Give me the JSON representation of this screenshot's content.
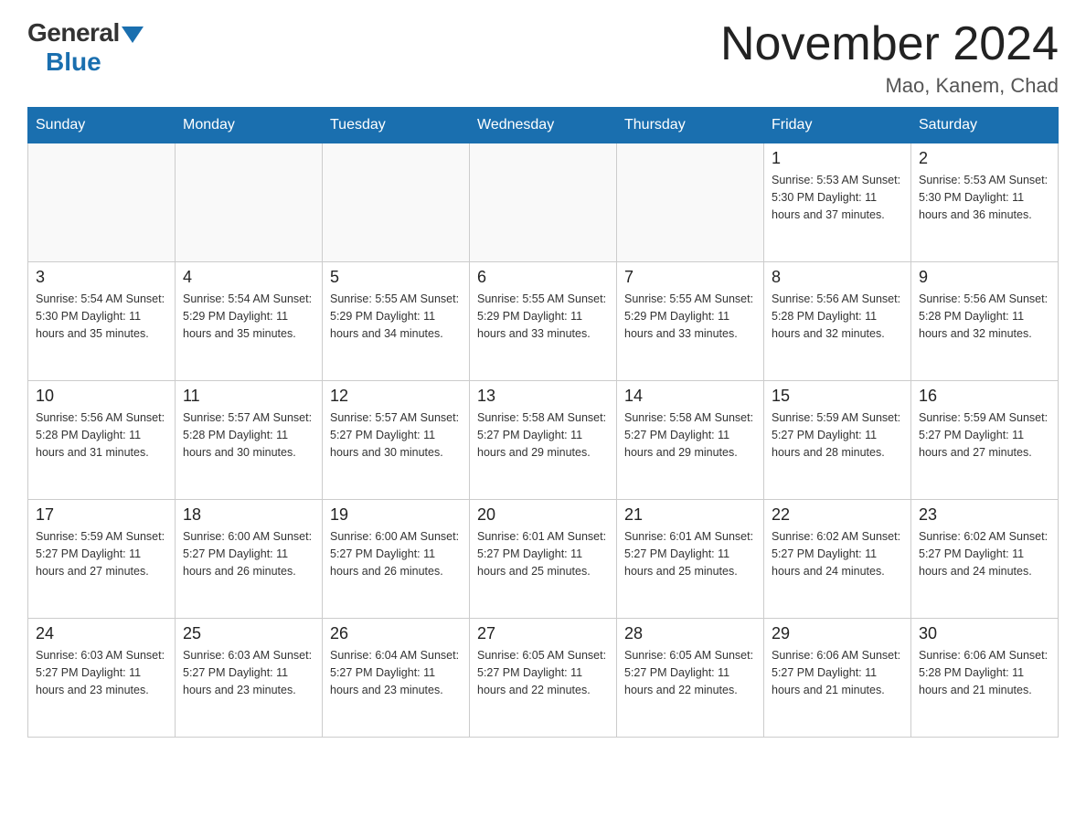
{
  "header": {
    "logo_general": "General",
    "logo_blue": "Blue",
    "month_title": "November 2024",
    "location": "Mao, Kanem, Chad"
  },
  "weekdays": [
    "Sunday",
    "Monday",
    "Tuesday",
    "Wednesday",
    "Thursday",
    "Friday",
    "Saturday"
  ],
  "weeks": [
    [
      {
        "day": "",
        "info": ""
      },
      {
        "day": "",
        "info": ""
      },
      {
        "day": "",
        "info": ""
      },
      {
        "day": "",
        "info": ""
      },
      {
        "day": "",
        "info": ""
      },
      {
        "day": "1",
        "info": "Sunrise: 5:53 AM\nSunset: 5:30 PM\nDaylight: 11 hours\nand 37 minutes."
      },
      {
        "day": "2",
        "info": "Sunrise: 5:53 AM\nSunset: 5:30 PM\nDaylight: 11 hours\nand 36 minutes."
      }
    ],
    [
      {
        "day": "3",
        "info": "Sunrise: 5:54 AM\nSunset: 5:30 PM\nDaylight: 11 hours\nand 35 minutes."
      },
      {
        "day": "4",
        "info": "Sunrise: 5:54 AM\nSunset: 5:29 PM\nDaylight: 11 hours\nand 35 minutes."
      },
      {
        "day": "5",
        "info": "Sunrise: 5:55 AM\nSunset: 5:29 PM\nDaylight: 11 hours\nand 34 minutes."
      },
      {
        "day": "6",
        "info": "Sunrise: 5:55 AM\nSunset: 5:29 PM\nDaylight: 11 hours\nand 33 minutes."
      },
      {
        "day": "7",
        "info": "Sunrise: 5:55 AM\nSunset: 5:29 PM\nDaylight: 11 hours\nand 33 minutes."
      },
      {
        "day": "8",
        "info": "Sunrise: 5:56 AM\nSunset: 5:28 PM\nDaylight: 11 hours\nand 32 minutes."
      },
      {
        "day": "9",
        "info": "Sunrise: 5:56 AM\nSunset: 5:28 PM\nDaylight: 11 hours\nand 32 minutes."
      }
    ],
    [
      {
        "day": "10",
        "info": "Sunrise: 5:56 AM\nSunset: 5:28 PM\nDaylight: 11 hours\nand 31 minutes."
      },
      {
        "day": "11",
        "info": "Sunrise: 5:57 AM\nSunset: 5:28 PM\nDaylight: 11 hours\nand 30 minutes."
      },
      {
        "day": "12",
        "info": "Sunrise: 5:57 AM\nSunset: 5:27 PM\nDaylight: 11 hours\nand 30 minutes."
      },
      {
        "day": "13",
        "info": "Sunrise: 5:58 AM\nSunset: 5:27 PM\nDaylight: 11 hours\nand 29 minutes."
      },
      {
        "day": "14",
        "info": "Sunrise: 5:58 AM\nSunset: 5:27 PM\nDaylight: 11 hours\nand 29 minutes."
      },
      {
        "day": "15",
        "info": "Sunrise: 5:59 AM\nSunset: 5:27 PM\nDaylight: 11 hours\nand 28 minutes."
      },
      {
        "day": "16",
        "info": "Sunrise: 5:59 AM\nSunset: 5:27 PM\nDaylight: 11 hours\nand 27 minutes."
      }
    ],
    [
      {
        "day": "17",
        "info": "Sunrise: 5:59 AM\nSunset: 5:27 PM\nDaylight: 11 hours\nand 27 minutes."
      },
      {
        "day": "18",
        "info": "Sunrise: 6:00 AM\nSunset: 5:27 PM\nDaylight: 11 hours\nand 26 minutes."
      },
      {
        "day": "19",
        "info": "Sunrise: 6:00 AM\nSunset: 5:27 PM\nDaylight: 11 hours\nand 26 minutes."
      },
      {
        "day": "20",
        "info": "Sunrise: 6:01 AM\nSunset: 5:27 PM\nDaylight: 11 hours\nand 25 minutes."
      },
      {
        "day": "21",
        "info": "Sunrise: 6:01 AM\nSunset: 5:27 PM\nDaylight: 11 hours\nand 25 minutes."
      },
      {
        "day": "22",
        "info": "Sunrise: 6:02 AM\nSunset: 5:27 PM\nDaylight: 11 hours\nand 24 minutes."
      },
      {
        "day": "23",
        "info": "Sunrise: 6:02 AM\nSunset: 5:27 PM\nDaylight: 11 hours\nand 24 minutes."
      }
    ],
    [
      {
        "day": "24",
        "info": "Sunrise: 6:03 AM\nSunset: 5:27 PM\nDaylight: 11 hours\nand 23 minutes."
      },
      {
        "day": "25",
        "info": "Sunrise: 6:03 AM\nSunset: 5:27 PM\nDaylight: 11 hours\nand 23 minutes."
      },
      {
        "day": "26",
        "info": "Sunrise: 6:04 AM\nSunset: 5:27 PM\nDaylight: 11 hours\nand 23 minutes."
      },
      {
        "day": "27",
        "info": "Sunrise: 6:05 AM\nSunset: 5:27 PM\nDaylight: 11 hours\nand 22 minutes."
      },
      {
        "day": "28",
        "info": "Sunrise: 6:05 AM\nSunset: 5:27 PM\nDaylight: 11 hours\nand 22 minutes."
      },
      {
        "day": "29",
        "info": "Sunrise: 6:06 AM\nSunset: 5:27 PM\nDaylight: 11 hours\nand 21 minutes."
      },
      {
        "day": "30",
        "info": "Sunrise: 6:06 AM\nSunset: 5:28 PM\nDaylight: 11 hours\nand 21 minutes."
      }
    ]
  ]
}
